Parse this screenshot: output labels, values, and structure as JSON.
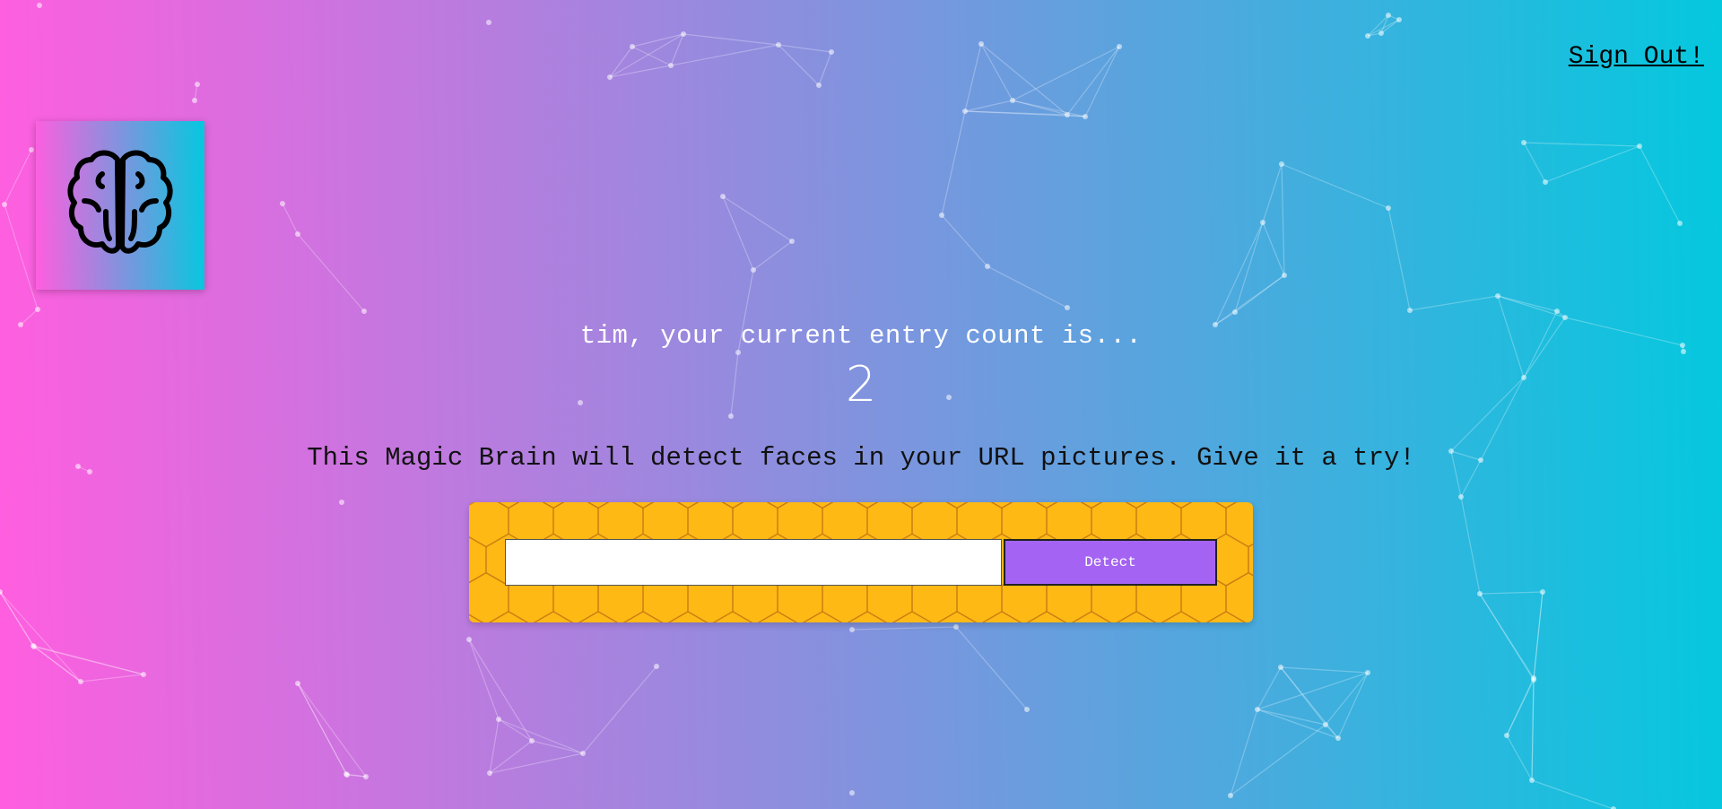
{
  "nav": {
    "signout_label": "Sign Out!"
  },
  "logo": {
    "icon": "brain-icon"
  },
  "rank": {
    "message": "tim, your current entry count is...",
    "count": "2"
  },
  "description": "This Magic Brain will detect faces in your URL pictures. Give it a try!",
  "form": {
    "input_value": "",
    "input_placeholder": "",
    "detect_label": "Detect"
  },
  "colors": {
    "gradient_start": "#ff5edf",
    "gradient_end": "#04c8de",
    "form_background": "#ffb914",
    "button_background": "#a463f2"
  }
}
